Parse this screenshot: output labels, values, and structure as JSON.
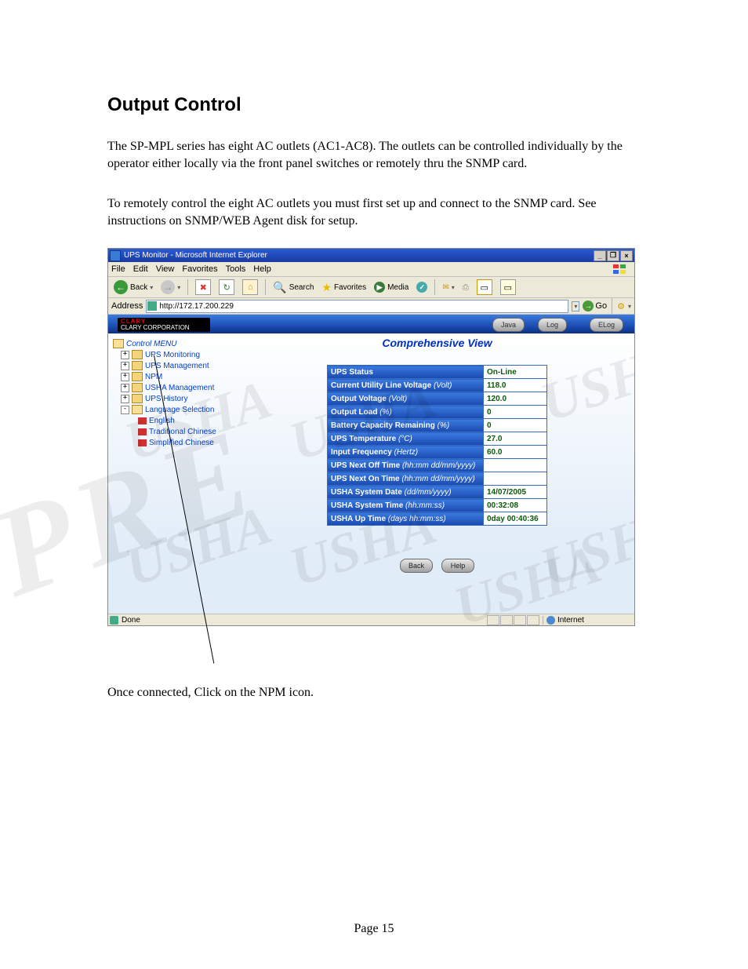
{
  "doc": {
    "heading": "Output Control",
    "para1": "The SP-MPL series has eight AC outlets (AC1-AC8).  The outlets can be controlled individually by the operator either locally via the front panel switches or remotely thru the SNMP card.",
    "para2": "To remotely control the eight AC outlets you must first set up and connect to the SNMP card.  See instructions on SNMP/WEB Agent disk for setup.",
    "caption": "Once connected, Click on the NPM icon.",
    "page_label": "Page 15"
  },
  "ie": {
    "title": "UPS Monitor - Microsoft Internet Explorer",
    "menus": {
      "file": "File",
      "edit": "Edit",
      "view": "View",
      "favorites": "Favorites",
      "tools": "Tools",
      "help": "Help"
    },
    "toolbar": {
      "back": "Back",
      "search": "Search",
      "favorites": "Favorites",
      "media": "Media"
    },
    "address_label": "Address",
    "address_value": "http://172.17.200.229",
    "go": "Go",
    "status_done": "Done",
    "status_zone": "Internet"
  },
  "brand": {
    "line1": "CLARY",
    "line2": "CLARY CORPORATION"
  },
  "pills": {
    "java": "Java",
    "log": "Log",
    "elog": "ELog",
    "back": "Back",
    "help": "Help"
  },
  "tree": {
    "root": "Control MENU",
    "items": [
      {
        "label": "UPS Monitoring",
        "pm": "+"
      },
      {
        "label": "UPS Management",
        "pm": "+"
      },
      {
        "label": "NPM",
        "pm": "+"
      },
      {
        "label": "USHA Management",
        "pm": "+"
      },
      {
        "label": "UPS History",
        "pm": "+"
      },
      {
        "label": "Language Selection",
        "pm": "-",
        "open": true
      }
    ],
    "langs": [
      "English",
      "Traditional Chinese",
      "Simplified Chinese"
    ]
  },
  "view_title": "Comprehensive View",
  "table": [
    {
      "k": "UPS Status",
      "u": "",
      "v": "On-Line"
    },
    {
      "k": "Current Utility Line Voltage ",
      "u": "(Volt)",
      "v": "118.0"
    },
    {
      "k": "Output Voltage ",
      "u": "(Volt)",
      "v": "120.0"
    },
    {
      "k": "Output Load ",
      "u": "(%)",
      "v": "0"
    },
    {
      "k": "Battery Capacity Remaining ",
      "u": "(%)",
      "v": "0"
    },
    {
      "k": "UPS Temperature ",
      "u": "(°C)",
      "v": "27.0"
    },
    {
      "k": "Input Frequency ",
      "u": "(Hertz)",
      "v": "60.0"
    },
    {
      "k": "UPS Next Off Time ",
      "u": "(hh:mm dd/mm/yyyy)",
      "v": ""
    },
    {
      "k": "UPS Next On Time ",
      "u": "(hh:mm dd/mm/yyyy)",
      "v": ""
    },
    {
      "k": "USHA System Date ",
      "u": "(dd/mm/yyyy)",
      "v": "14/07/2005"
    },
    {
      "k": "USHA System Time ",
      "u": "(hh:mm:ss)",
      "v": "00:32:08"
    },
    {
      "k": "USHA Up Time ",
      "u": "(days hh:mm:ss)",
      "v": "0day 00:40:36"
    }
  ]
}
